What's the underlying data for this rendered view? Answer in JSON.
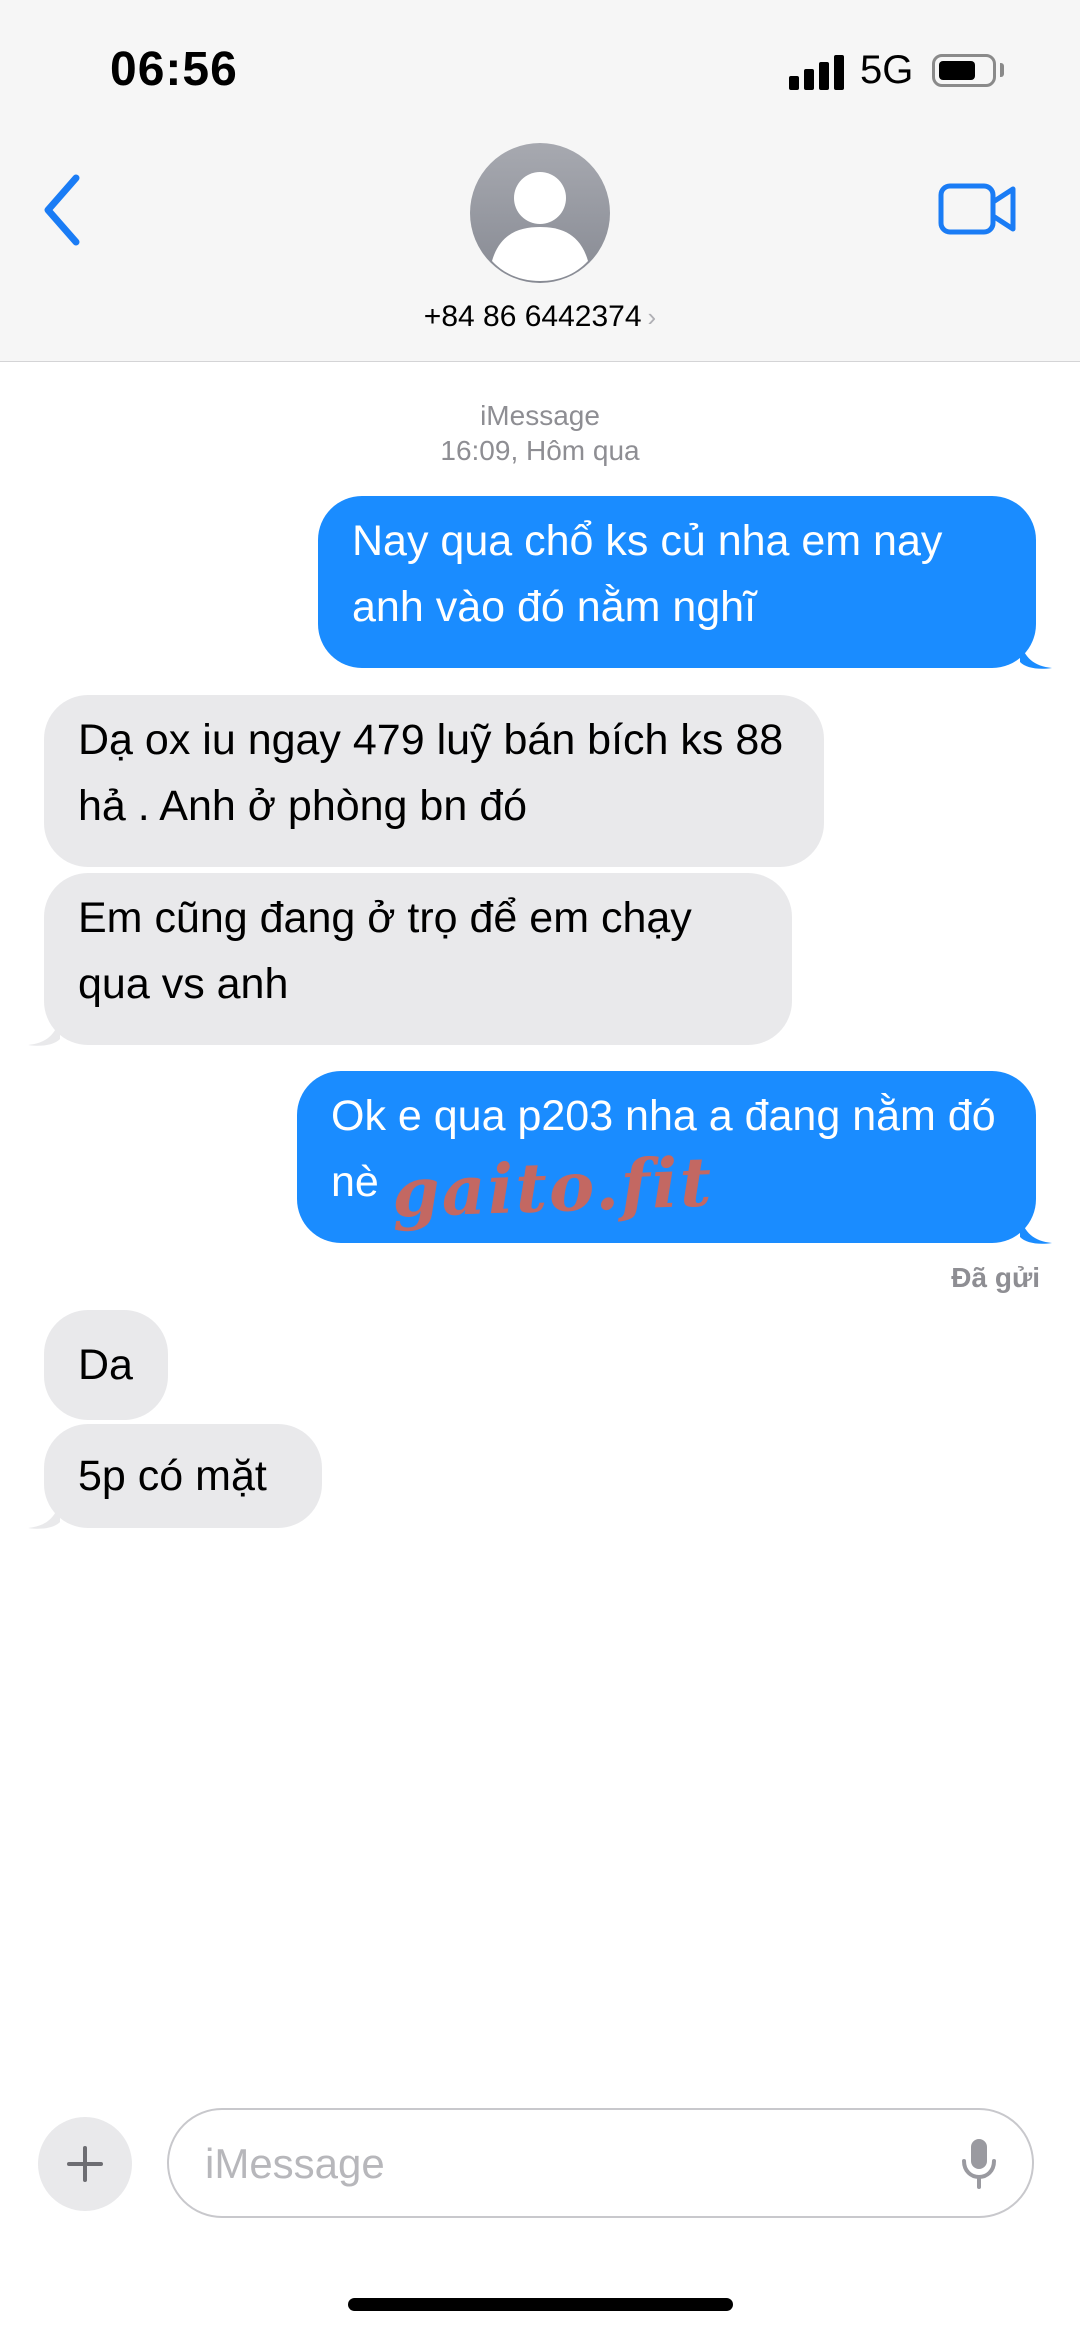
{
  "status_bar": {
    "time": "06:56",
    "network": "5G",
    "signal_bars": 4,
    "battery_level": 0.7
  },
  "header": {
    "back_icon": "chevron-left-icon",
    "contact_name": "+84 86 6442374",
    "contact_chevron": "›",
    "video_icon": "video-camera-icon",
    "accent_color": "#1a7cf5"
  },
  "thread": {
    "service": "iMessage",
    "timestamp": "16:09, Hôm qua",
    "delivered_label": "Đã gửi",
    "messages": [
      {
        "direction": "outgoing",
        "text": "Nay qua chổ ks củ nha em nay anh vào đó nằm nghĩ"
      },
      {
        "direction": "incoming",
        "text": "Dạ ox iu ngay 479 luỹ bán bích ks 88 hả . Anh ở phòng bn đó"
      },
      {
        "direction": "incoming",
        "text": "Em cũng đang ở trọ để em chạy qua vs anh"
      },
      {
        "direction": "outgoing",
        "text": "Ok e qua p203 nha a đang nằm đó nè"
      },
      {
        "direction": "incoming",
        "text": "Da"
      },
      {
        "direction": "incoming",
        "text": "5p có mặt"
      }
    ],
    "outgoing_color": "#1a8cff",
    "incoming_color": "#e9e9eb"
  },
  "watermark": "gaito.fit",
  "compose": {
    "plus_icon": "plus-icon",
    "placeholder": "iMessage",
    "mic_icon": "microphone-icon"
  }
}
